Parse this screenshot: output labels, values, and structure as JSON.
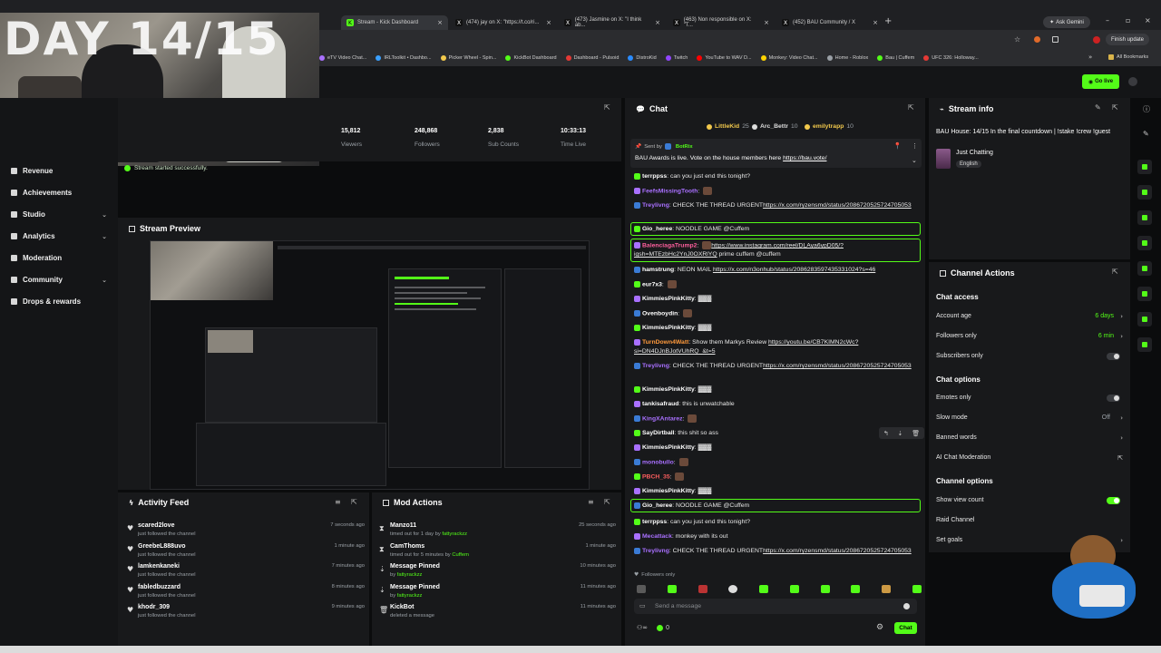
{
  "overlay": {
    "day_text": "DAY 14/15"
  },
  "browser": {
    "tabs": [
      {
        "label": "Stream - Kick Dashboard",
        "icon": "kick-icon"
      },
      {
        "label": "(474) jay on X: \"https://t.co/ri...",
        "icon": "x-icon"
      },
      {
        "label": "(473) Jasmine on X: \"I think ab...",
        "icon": "x-icon"
      },
      {
        "label": "(463) Non responsible on X: \"T...",
        "icon": "x-icon"
      },
      {
        "label": "(452) BAU Community / X",
        "icon": "x-icon"
      }
    ],
    "ask_gemini": "Ask Gemini",
    "finish_update": "Finish update",
    "bookmarks": [
      "eTV Video Chat...",
      "IRLToolkit • Dashbo...",
      "Picker Wheel - Spin...",
      "KickBot Dashboard",
      "Dashboard - Pulsoid",
      "DistroKid",
      "Twitch",
      "YouTube to WAV D...",
      "Monkey: Video Chat...",
      "Home - Roblox",
      "Bau | Cuffem",
      "UFC 326: Holloway..."
    ],
    "all_bookmarks": "All Bookmarks"
  },
  "header": {
    "go_live": "Go live"
  },
  "sidebar": {
    "items": [
      {
        "label": "Revenue",
        "chevron": false
      },
      {
        "label": "Achievements",
        "chevron": false
      },
      {
        "label": "Studio",
        "chevron": true
      },
      {
        "label": "Analytics",
        "chevron": true
      },
      {
        "label": "Moderation",
        "chevron": false
      },
      {
        "label": "Community",
        "chevron": true
      },
      {
        "label": "Drops & rewards",
        "chevron": false
      }
    ]
  },
  "stats": [
    {
      "value": "15,812",
      "label": "Viewers"
    },
    {
      "value": "248,868",
      "label": "Followers"
    },
    {
      "value": "2,838",
      "label": "Sub Counts"
    },
    {
      "value": "10:33:13",
      "label": "Time Live"
    }
  ],
  "toast": "Stream started successfully.",
  "preview": {
    "title": "Stream Preview"
  },
  "activity": {
    "title": "Activity Feed",
    "items": [
      {
        "name": "scared2love",
        "sub": "just followed the channel",
        "time": "7 seconds ago"
      },
      {
        "name": "GreebeL888uvo",
        "sub": "just followed the channel",
        "time": "1 minute ago"
      },
      {
        "name": "lamkenkaneki",
        "sub": "just followed the channel",
        "time": "7 minutes ago"
      },
      {
        "name": "fabledbuzzard",
        "sub": "just followed the channel",
        "time": "8 minutes ago"
      },
      {
        "name": "khodr_309",
        "sub": "just followed the channel",
        "time": "9 minutes ago"
      }
    ]
  },
  "mod": {
    "title": "Mod Actions",
    "items": [
      {
        "name": "Manzo11",
        "sub": "timed out for 1 day by ",
        "by": "fattyrackzz",
        "time": "25 seconds ago",
        "icon": "hourglass-icon"
      },
      {
        "name": "CamThoms",
        "sub": "timed out for 5 minutes by ",
        "by": "Cuffem",
        "time": "1 minute ago",
        "icon": "hourglass-icon"
      },
      {
        "name": "Message Pinned",
        "sub": "by ",
        "by": "fattyrackzz",
        "time": "10 minutes ago",
        "icon": "pin-icon"
      },
      {
        "name": "Message Pinned",
        "sub": "by ",
        "by": "fattyrackzz",
        "time": "11 minutes ago",
        "icon": "pin-icon"
      },
      {
        "name": "KickBot",
        "sub": "deleted a message",
        "by": "",
        "time": "11 minutes ago",
        "icon": "trash-icon"
      }
    ]
  },
  "chat": {
    "title": "Chat",
    "top_gifters": [
      {
        "name": "LittleKid",
        "count": "25"
      },
      {
        "name": "Arc_Bettr",
        "count": "10"
      },
      {
        "name": "emilytrapp",
        "count": "10"
      }
    ],
    "pinned": {
      "sent_by": "Sent by",
      "bot": "BotRix",
      "text": "BAU Awards is live. Vote on the house members here ",
      "link": "https://bau.vote/"
    },
    "messages": [
      {
        "user": "terrppss",
        "color": "#ffffff",
        "text": "can you just end this tonight?"
      },
      {
        "user": "FeefsMissingTooth",
        "color": "#a970ff",
        "text": ""
      },
      {
        "user": "Treylivng",
        "color": "#a970ff",
        "text": "CHECK THE THREAD URGENT",
        "link": "https://x.com/ryzensmd/status/2086720525724705053"
      },
      {
        "user": "Gio_heree",
        "color": "#ffffff",
        "text": "NOODLE GAME @Cuffem",
        "highlight": true
      },
      {
        "user": "BalenciagaTrump2",
        "color": "#ff5f9e",
        "text": "",
        "link": "https://www.instagram.com/reel/DLAya6ypD05/?igsh=MTEzbHc2YnJ0OXRlYQ",
        "tail": " prime cuffem @cuffem",
        "highlight": true
      },
      {
        "user": "hamstrung",
        "color": "#ffffff",
        "text": "NEON MAIL ",
        "link": "https://x.com/n3onhub/status/2086283597435331024?s=46"
      },
      {
        "user": "eur7x3",
        "color": "#ffffff",
        "text": ""
      },
      {
        "user": "KimmiesPinkKitty",
        "color": "#ffffff",
        "text": "▓▓▓"
      },
      {
        "user": "Ovenboydin",
        "color": "#ffffff",
        "text": ""
      },
      {
        "user": "KimmiesPinkKitty",
        "color": "#ffffff",
        "text": "▓▓▓"
      },
      {
        "user": "TurnDown4Watt",
        "color": "#ff9a3c",
        "text": "Show them Markys Review ",
        "link": "https://youtu.be/CB7KIMN2cWc?si=DN4DJnBJotVUhRQ_&t=5"
      },
      {
        "user": "Treylivng",
        "color": "#a970ff",
        "text": "CHECK THE THREAD URGENT",
        "link": "https://x.com/ryzensmd/status/2086720525724705053"
      },
      {
        "user": "KimmiesPinkKitty",
        "color": "#ffffff",
        "text": "▓▓▓"
      },
      {
        "user": "tankisafraud",
        "color": "#ffffff",
        "text": "this is unwatchable"
      },
      {
        "user": "KingXAntarez",
        "color": "#a970ff",
        "text": ""
      },
      {
        "user": "SayDirtball",
        "color": "#ffffff",
        "text": "this shit so ass"
      },
      {
        "user": "KimmiesPinkKitty",
        "color": "#ffffff",
        "text": "▓▓▓"
      },
      {
        "user": "monobullo",
        "color": "#a970ff",
        "text": ""
      },
      {
        "user": "PBCH_35",
        "color": "#ff5f5f",
        "text": ""
      },
      {
        "user": "KimmiesPinkKitty",
        "color": "#ffffff",
        "text": "▓▓▓"
      },
      {
        "user": "Gio_heree",
        "color": "#ffffff",
        "text": "NOODLE GAME @Cuffem",
        "highlight": true
      },
      {
        "user": "terrppss",
        "color": "#ffffff",
        "text": "can you just end this tonight?"
      },
      {
        "user": "Mecattack",
        "color": "#a970ff",
        "text": "monkey with its out"
      },
      {
        "user": "Treylivng",
        "color": "#a970ff",
        "text": "CHECK THE THREAD URGENT",
        "link": "https://x.com/ryzensmd/status/2086720525724705053"
      }
    ],
    "followers_only": "Followers only",
    "placeholder": "Send a message",
    "send_label": "Chat",
    "points": "0"
  },
  "stream_info": {
    "title_label": "Stream info",
    "stream_title": "BAU House: 14/15 In the final countdown | !stake !crew !guest",
    "category": "Just Chatting",
    "language": "English"
  },
  "actions": {
    "title": "Channel Actions",
    "chat_access": "Chat access",
    "account_age": {
      "label": "Account age",
      "value": "6 days"
    },
    "followers_only": {
      "label": "Followers only",
      "value": "6 min"
    },
    "subscribers_only": "Subscribers only",
    "chat_options": "Chat options",
    "emotes_only": "Emotes only",
    "slow_mode": {
      "label": "Slow mode",
      "value": "Off"
    },
    "banned_words": "Banned words",
    "ai_moderation": "AI Chat Moderation",
    "channel_options": "Channel options",
    "show_view_count": "Show view count",
    "raid_channel": "Raid Channel",
    "set_goals": "Set goals"
  },
  "colors": {
    "accent": "#53fc18",
    "bg": "#0b0c0d",
    "panel": "#18191b"
  }
}
